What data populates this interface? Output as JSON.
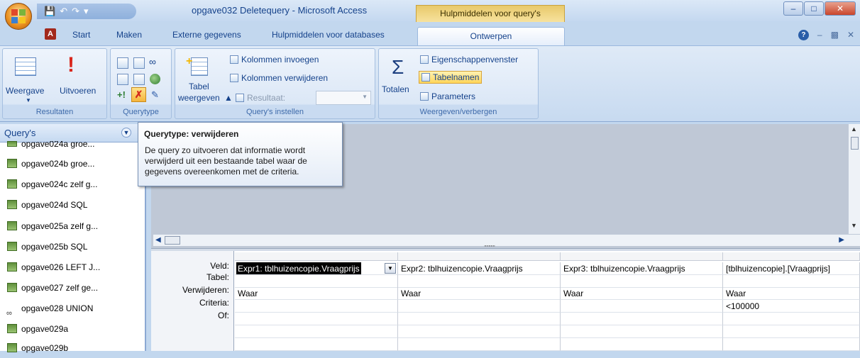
{
  "window": {
    "title": "opgave032 Deletequery - Microsoft Access",
    "context_tab": "Hulpmiddelen voor query's"
  },
  "tabs": [
    {
      "label": "Start"
    },
    {
      "label": "Maken"
    },
    {
      "label": "Externe gegevens"
    },
    {
      "label": "Hulpmiddelen voor databases"
    },
    {
      "label": "Ontwerpen"
    }
  ],
  "ribbon": {
    "resultaten": {
      "label": "Resultaten",
      "weergave": "Weergave",
      "uitvoeren": "Uitvoeren"
    },
    "querytype": {
      "label": "Querytype"
    },
    "instellen": {
      "label": "Query's instellen",
      "tabel": "Tabel",
      "weergeven": "weergeven",
      "kolommen_invoegen": "Kolommen invoegen",
      "kolommen_verwijderen": "Kolommen verwijderen",
      "resultaat": "Resultaat:"
    },
    "weergeven": {
      "label": "Weergeven/verbergen",
      "totalen": "Totalen",
      "eigenschappen": "Eigenschappenvenster",
      "tabelnamen": "Tabelnamen",
      "parameters": "Parameters"
    }
  },
  "nav": {
    "header": "Query's",
    "items": [
      {
        "label": "opgave024a groe..."
      },
      {
        "label": "opgave024b groe..."
      },
      {
        "label": "opgave024c zelf g..."
      },
      {
        "label": "opgave024d SQL"
      },
      {
        "label": "opgave025a zelf g..."
      },
      {
        "label": "opgave025b SQL"
      },
      {
        "label": "opgave026 LEFT J..."
      },
      {
        "label": "opgave027 zelf ge..."
      },
      {
        "label": "opgave028 UNION"
      },
      {
        "label": "opgave029a"
      },
      {
        "label": "opgave029b"
      }
    ]
  },
  "tooltip": {
    "title": "Querytype: verwijderen",
    "body": "De query zo uitvoeren dat informatie wordt verwijderd uit een bestaande tabel waar de gegevens overeenkomen met de criteria."
  },
  "grid": {
    "row_labels": {
      "veld": "Veld:",
      "tabel": "Tabel:",
      "verwijderen": "Verwijderen:",
      "criteria": "Criteria:",
      "of": "Of:"
    },
    "columns": [
      {
        "veld": "Expr1: tblhuizencopie.Vraagprijs",
        "verwijderen": "Waar",
        "criteria": ""
      },
      {
        "veld": "Expr2: tblhuizencopie.Vraagprijs",
        "verwijderen": "Waar",
        "criteria": ""
      },
      {
        "veld": "Expr3: tblhuizencopie.Vraagprijs",
        "verwijderen": "Waar",
        "criteria": ""
      },
      {
        "veld": "[tblhuizencopie].[Vraagprijs]",
        "verwijderen": "Waar",
        "criteria": "<100000"
      }
    ]
  }
}
